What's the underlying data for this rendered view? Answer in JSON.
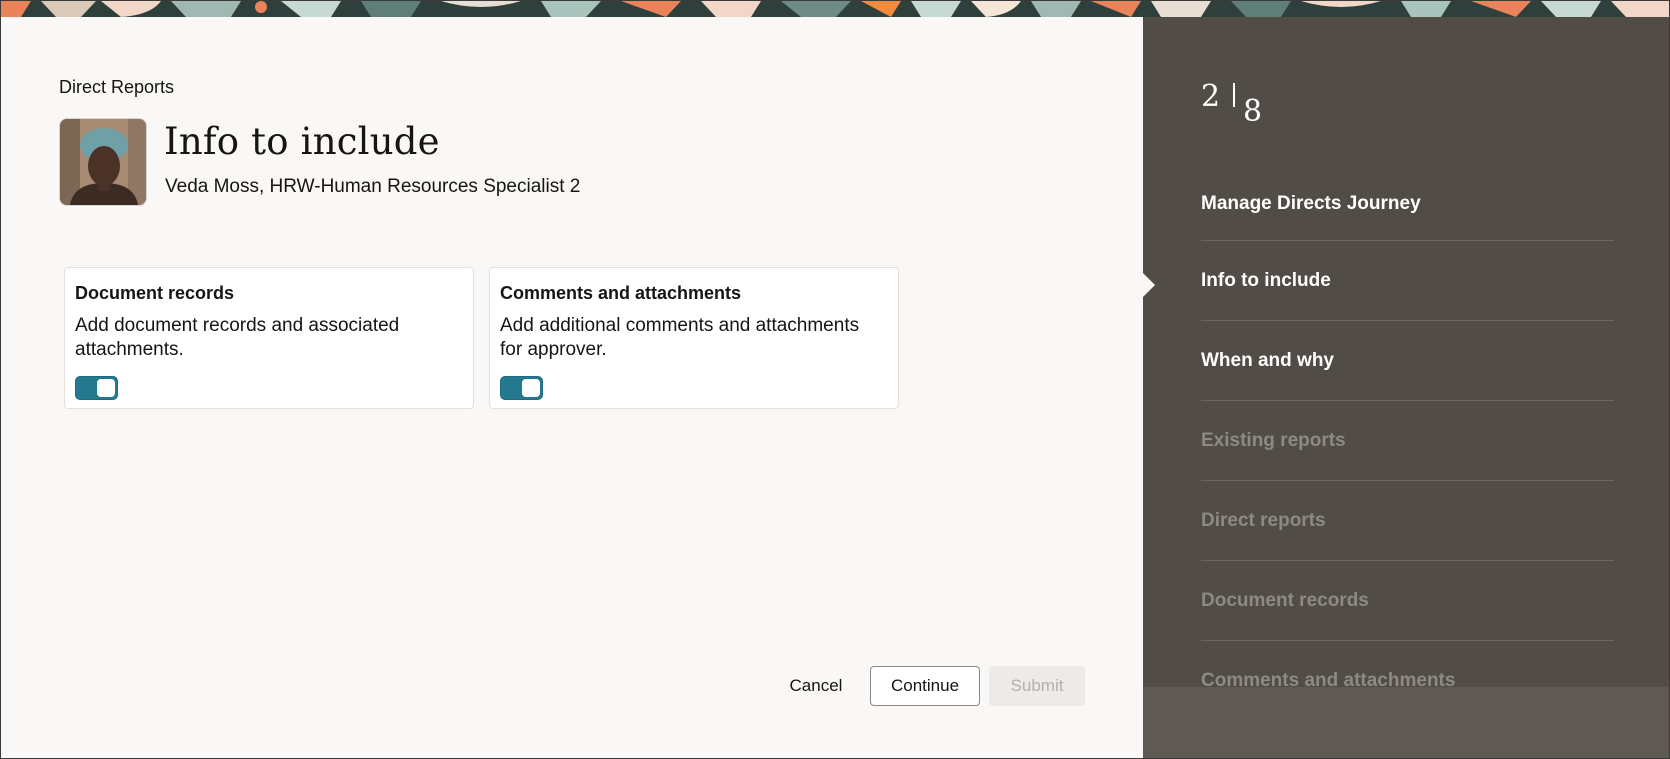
{
  "colors": {
    "accent": "#25798f",
    "side_panel": "#514c46",
    "background": "#faf8f6"
  },
  "main": {
    "section_label": "Direct Reports",
    "title": "Info to include",
    "person": "Veda Moss, HRW-Human Resources Specialist 2",
    "cards": [
      {
        "title": "Document records",
        "description": "Add document records and associated attachments.",
        "toggle_on": true
      },
      {
        "title": "Comments and attachments",
        "description": "Add additional comments and attachments for approver.",
        "toggle_on": true
      }
    ]
  },
  "footer": {
    "cancel_label": "Cancel",
    "continue_label": "Continue",
    "submit_label": "Submit"
  },
  "sidebar": {
    "current_step": "2",
    "total_steps": "8",
    "steps": [
      {
        "label": "Manage Directs Journey",
        "state": "enabled"
      },
      {
        "label": "Info to include",
        "state": "current"
      },
      {
        "label": "When and why",
        "state": "enabled"
      },
      {
        "label": "Existing reports",
        "state": "disabled"
      },
      {
        "label": "Direct reports",
        "state": "disabled"
      },
      {
        "label": "Document records",
        "state": "disabled"
      },
      {
        "label": "Comments and attachments",
        "state": "disabled"
      }
    ]
  }
}
